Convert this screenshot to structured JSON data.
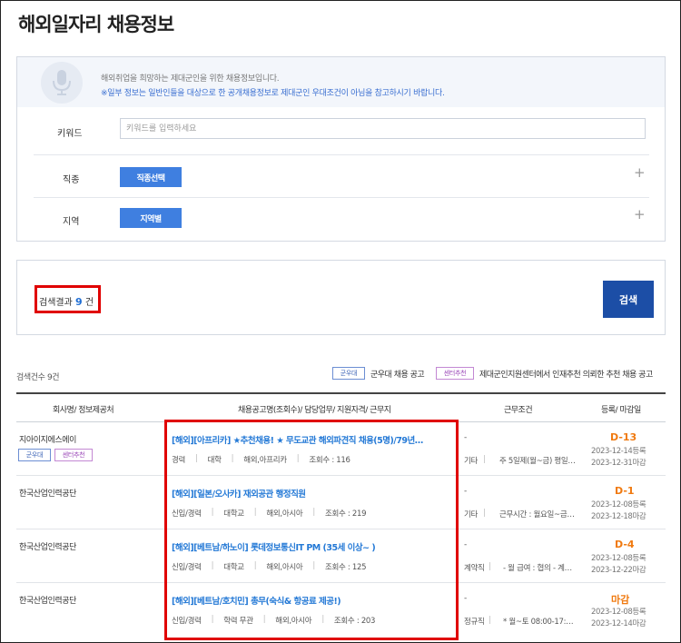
{
  "page": {
    "title": "해외일자리 채용정보"
  },
  "notice": {
    "line1": "해외취업을 희망하는 제대군인을 위한 채용정보입니다.",
    "line2": "※일부 정보는 일반인들을 대상으로 한 공개채용정보로 제대군인 우대조건이 아님을 참고하시기 바랍니다."
  },
  "form": {
    "keyword_label": "키워드",
    "keyword_placeholder": "키워드를 입력하세요",
    "job_label": "직종",
    "job_button": "직종선택",
    "region_label": "지역",
    "region_button": "지역별",
    "plus": "+"
  },
  "result": {
    "prefix": "검색결과",
    "count": "9",
    "suffix": "건",
    "search_button": "검색"
  },
  "list": {
    "count_text": "검색건수 9건",
    "legend_military_tag": "군우대",
    "legend_military_text": "군우대 채용 공고",
    "legend_center_tag": "센터추천",
    "legend_center_text": "제대군인지원센터에서 인재추천 의뢰한 추천 채용 공고"
  },
  "table": {
    "headers": [
      "회사명/ 정보제공처",
      "채용공고명(조회수)/ 담당업무/ 지원자격/ 근무지",
      "근무조건",
      "등록/ 마감일"
    ],
    "rows": [
      {
        "company": "지아이지에스에이",
        "tags": [
          "군우대",
          "센터추천"
        ],
        "title": "[해외][아프리카] ★추천채용! ★ 무도교관 해외파견직 채용(5명)/79년…",
        "meta": [
          "경력",
          "대학",
          "해외,아프리카",
          "조회수 : 116"
        ],
        "cond_dash": "-",
        "cond_type": "기타",
        "cond_detail": "주 5일제(월~금) 평일…",
        "dday": "D-13",
        "reg": "2023-12-14등록",
        "due": "2023-12-31마감"
      },
      {
        "company": "한국산업인력공단",
        "tags": [],
        "title": "[해외][일본/오사카] 재외공관 행정직원",
        "meta": [
          "신입/경력",
          "대학교",
          "해외,아시아",
          "조회수 : 219"
        ],
        "cond_dash": "-",
        "cond_type": "기타",
        "cond_detail": "근무시간 : 월요일~금…",
        "dday": "D-1",
        "reg": "2023-12-08등록",
        "due": "2023-12-18마감"
      },
      {
        "company": "한국산업인력공단",
        "tags": [],
        "title": "[해외][베트남/하노이] 롯데정보통신IT PM (35세 이상~ )",
        "meta": [
          "신입/경력",
          "대학교",
          "해외,아시아",
          "조회수 : 125"
        ],
        "cond_dash": "-",
        "cond_type": "계약직",
        "cond_detail": "- 월 급여 : 협의 - 계…",
        "dday": "D-4",
        "reg": "2023-12-08등록",
        "due": "2023-12-22마감"
      },
      {
        "company": "한국산업인력공단",
        "tags": [],
        "title": "[해외][베트남/호치민] 총무(숙식& 항공료 제공!)",
        "meta": [
          "신입/경력",
          "학력 무관",
          "해외,아시아",
          "조회수 : 203"
        ],
        "cond_dash": "-",
        "cond_type": "정규직",
        "cond_detail": "* 월~토 08:00-17:…",
        "dday": "마감",
        "reg": "2023-12-08등록",
        "due": "2023-12-14마감"
      }
    ]
  },
  "colors": {
    "accent": "#3f7fe0",
    "search_button": "#1c4ea6",
    "link": "#2479d6",
    "dday": "#f07a10",
    "highlight": "#e00000"
  }
}
